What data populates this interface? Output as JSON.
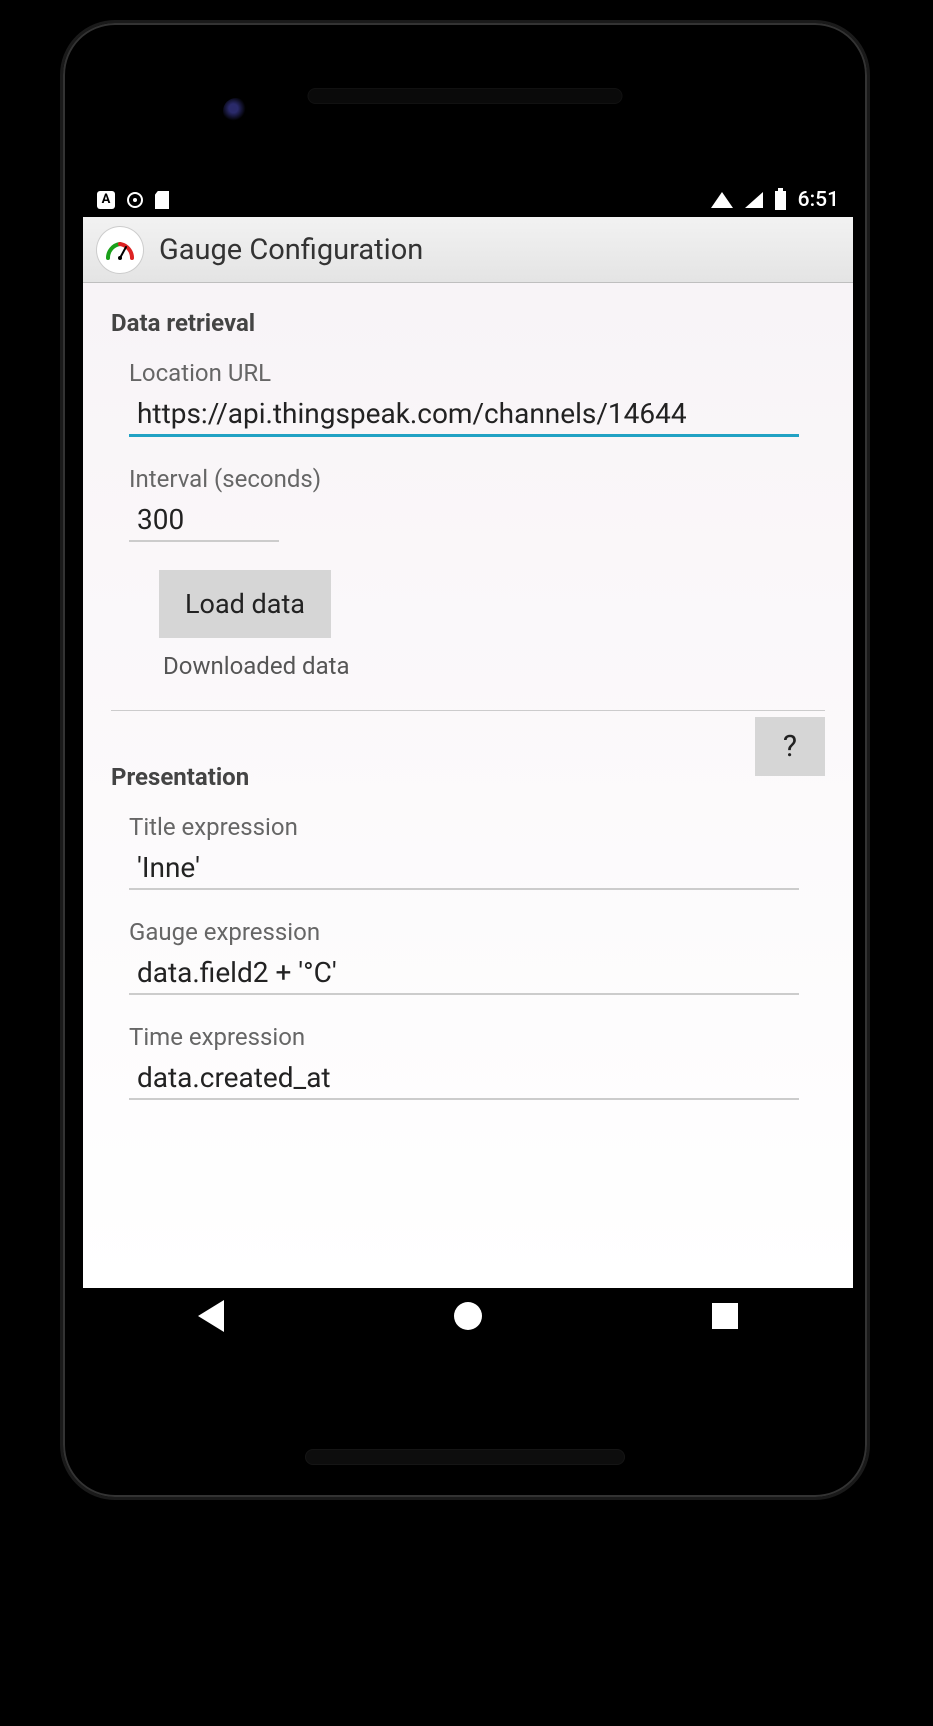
{
  "statusbar": {
    "time": "6:51"
  },
  "appbar": {
    "title": "Gauge Configuration"
  },
  "data_retrieval": {
    "header": "Data retrieval",
    "url_label": "Location URL",
    "url_value": "https://api.thingspeak.com/channels/14644",
    "interval_label": "Interval (seconds)",
    "interval_value": "300",
    "load_button": "Load data",
    "load_status": "Downloaded data"
  },
  "presentation": {
    "header": "Presentation",
    "help_label": "?",
    "title_label": "Title expression",
    "title_value": "'Inne'",
    "gauge_label": "Gauge expression",
    "gauge_value": "data.field2 + '°C'",
    "time_label": "Time expression",
    "time_value": "data.created_at"
  }
}
